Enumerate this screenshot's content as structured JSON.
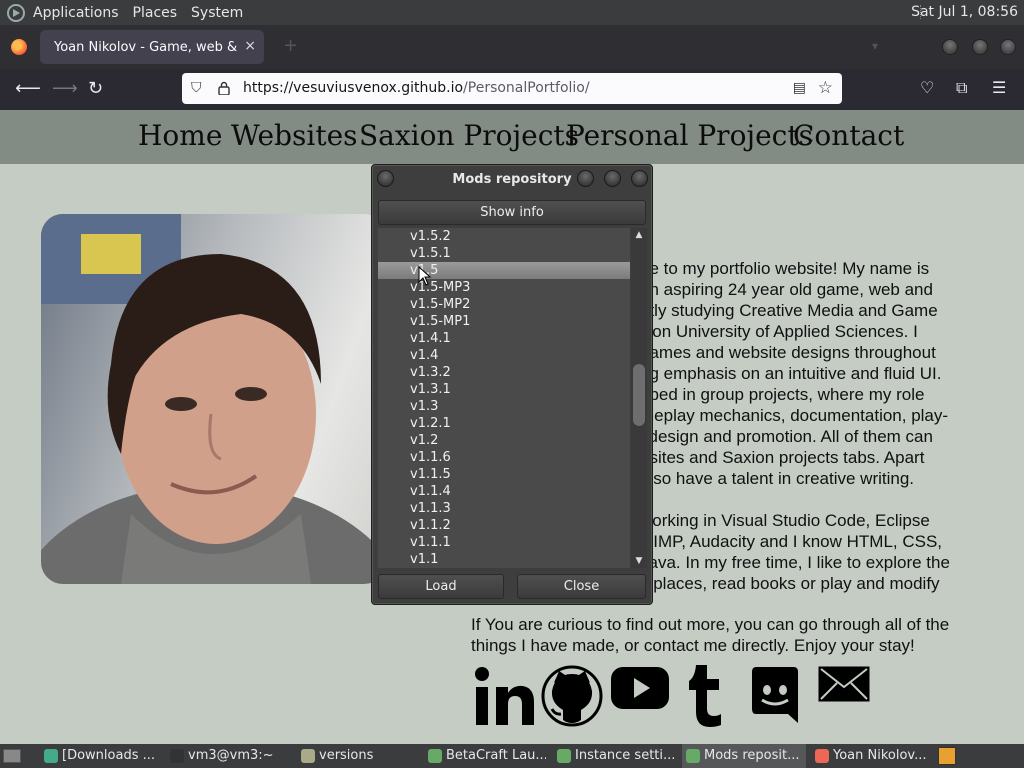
{
  "top_panel": {
    "menus": [
      "Applications",
      "Places",
      "System"
    ],
    "clock": "Sat Jul  1, 08:56"
  },
  "browser": {
    "tab_title": "Yoan Nikolov - Game, web & UI",
    "tab_close": "×",
    "new_tab": "+",
    "url_host": "https://vesuviusvenox.github.io",
    "url_path": "/PersonalPortfolio/"
  },
  "site": {
    "nav": [
      "Home",
      "Websites",
      "Saxion Projects",
      "Personal Projects",
      "Contact"
    ],
    "bio_p1": "ne to my portfolio website! My name is\n an aspiring 24 year old game, web and\nntly studying Creative Media and Game\nxion University of Applied Sciences. I\n games and website designs throughout\nng emphasis on an intuitive and fluid UI.\noped in group projects, where my role\nmeplay mechanics, documentation, play-\nl design and promotion. All of them can\nosites and Saxion projects tabs. Apart\n also have a talent in creative writing.",
    "bio_p2": " working in Visual Studio Code, Eclipse\nGIMP, Audacity and I know HTML, CSS,\n Java. In my free time, I like to explore the\ny places, read books or play and modify",
    "closing": "If You are curious to find out more, you can go through all of the things I have made, or contact me directly. Enjoy your stay!",
    "socials": [
      "linkedin-icon",
      "github-icon",
      "youtube-icon",
      "tumblr-icon",
      "discord-icon",
      "mail-icon"
    ]
  },
  "dialog": {
    "title": "Mods repository",
    "show_info": "Show info",
    "load": "Load",
    "close": "Close",
    "versions": [
      "v1.5.2",
      "v1.5.1",
      "v1.5",
      "v1.5-MP3",
      "v1.5-MP2",
      "v1.5-MP1",
      "v1.4.1",
      "v1.4",
      "v1.3.2",
      "v1.3.1",
      "v1.3",
      "v1.2.1",
      "v1.2",
      "v1.1.6",
      "v1.1.5",
      "v1.1.4",
      "v1.1.3",
      "v1.1.2",
      "v1.1.1",
      "v1.1"
    ],
    "selected_version": "v1.5",
    "scroll_up": "^",
    "scroll_down": "v"
  },
  "taskbar": {
    "tasks": [
      "[Downloads ...",
      "vm3@vm3:~",
      "versions",
      "BetaCraft Lau...",
      "Instance setti...",
      "Mods reposit...",
      "Yoan Nikolov..."
    ],
    "active_task": "Mods reposit..."
  }
}
